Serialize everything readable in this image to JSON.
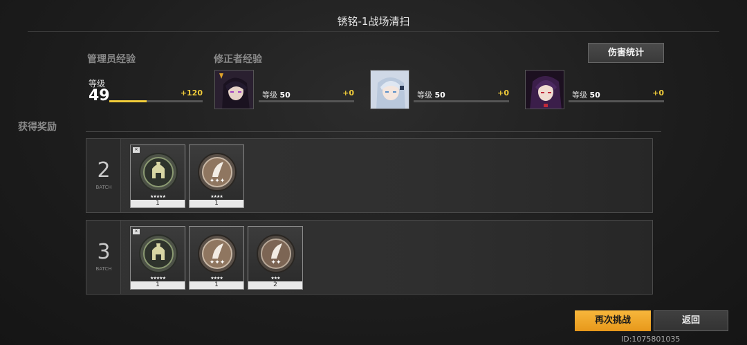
{
  "title": "锈铭-1战场清扫",
  "sections": {
    "admin_exp": "管理员经验",
    "corrector_exp": "修正者经验",
    "rewards": "获得奖励"
  },
  "damage_button": "伤害统计",
  "admin": {
    "level_label": "等级",
    "level": "49",
    "gain": "+120",
    "progress": 0.4
  },
  "characters": [
    {
      "level_label": "等级",
      "level": "50",
      "gain": "+0"
    },
    {
      "level_label": "等级",
      "level": "50",
      "gain": "+0"
    },
    {
      "level_label": "等级",
      "level": "50",
      "gain": "+0"
    }
  ],
  "batches": [
    {
      "number": "2",
      "word": "BATCH",
      "items": [
        {
          "icon": "helmet-medal-icon",
          "stars": "★★★★★",
          "count": "1",
          "rarity_color": "#e7b21e"
        },
        {
          "icon": "feather-medal-icon",
          "stars": "★★★★",
          "count": "1",
          "rarity_color": "#8a5fd0"
        }
      ]
    },
    {
      "number": "3",
      "word": "BATCH",
      "items": [
        {
          "icon": "helmet-medal-icon",
          "stars": "★★★★★",
          "count": "1",
          "rarity_color": "#e7b21e"
        },
        {
          "icon": "feather-medal-icon",
          "stars": "★★★★",
          "count": "1",
          "rarity_color": "#8a5fd0"
        },
        {
          "icon": "feather-medal-icon",
          "stars": "★★★",
          "count": "2",
          "rarity_color": "#4f8fd6"
        }
      ]
    }
  ],
  "buttons": {
    "retry": "再次挑战",
    "back": "返回"
  },
  "uid": "ID:1075801035"
}
